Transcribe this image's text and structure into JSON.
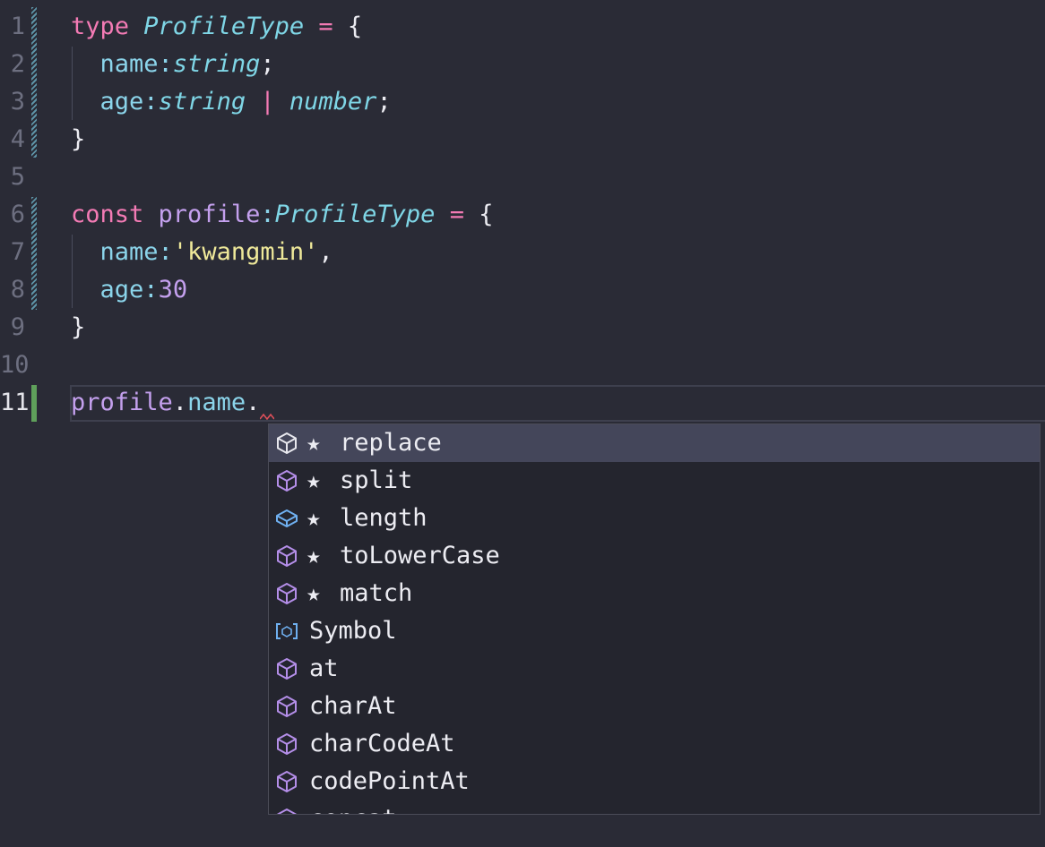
{
  "gutter": {
    "line_numbers": [
      "1",
      "2",
      "3",
      "4",
      "5",
      "6",
      "7",
      "8",
      "9",
      "10",
      "11"
    ]
  },
  "code": {
    "l1": {
      "kw": "type",
      "name": "ProfileType",
      "eq": "=",
      "brace": "{"
    },
    "l2": {
      "prop": "name",
      "colon": ":",
      "type": "string",
      "semi": ";"
    },
    "l3": {
      "prop": "age",
      "colon": ":",
      "type1": "string",
      "pipe": "|",
      "type2": "number",
      "semi": ";"
    },
    "l4": {
      "brace": "}"
    },
    "l6": {
      "kw": "const",
      "var": "profile",
      "colon": ":",
      "type": "ProfileType",
      "eq": "=",
      "brace": "{"
    },
    "l7": {
      "prop": "name",
      "colon": ":",
      "str": "'kwangmin'",
      "comma": ","
    },
    "l8": {
      "prop": "age",
      "colon": ":",
      "num": "30"
    },
    "l9": {
      "brace": "}"
    },
    "l11": {
      "var": "profile",
      "dot1": ".",
      "prop": "name",
      "dot2": "."
    }
  },
  "suggestions": [
    {
      "label": "replace",
      "starred": true,
      "icon": "method-icon",
      "star": "★"
    },
    {
      "label": "split",
      "starred": true,
      "icon": "method-icon",
      "star": "★"
    },
    {
      "label": "length",
      "starred": true,
      "icon": "property-icon",
      "star": "★"
    },
    {
      "label": "toLowerCase",
      "starred": true,
      "icon": "method-icon",
      "star": "★"
    },
    {
      "label": "match",
      "starred": true,
      "icon": "method-icon",
      "star": "★"
    },
    {
      "label": "Symbol",
      "starred": false,
      "icon": "symbol-icon"
    },
    {
      "label": "at",
      "starred": false,
      "icon": "method-icon"
    },
    {
      "label": "charAt",
      "starred": false,
      "icon": "method-icon"
    },
    {
      "label": "charCodeAt",
      "starred": false,
      "icon": "method-icon"
    },
    {
      "label": "codePointAt",
      "starred": false,
      "icon": "method-icon"
    },
    {
      "label": "concat",
      "starred": false,
      "icon": "method-icon"
    }
  ],
  "colors": {
    "background": "#2a2b36",
    "keyword": "#f47bb5",
    "type": "#7fd6e6",
    "property": "#8bd4ea",
    "variable": "#c4a0ee",
    "string": "#efe99a",
    "method_icon": "#b48ee8",
    "property_icon": "#6fb0f0",
    "selected_row": "#44465a",
    "gutter_added": "#5fa05b"
  }
}
